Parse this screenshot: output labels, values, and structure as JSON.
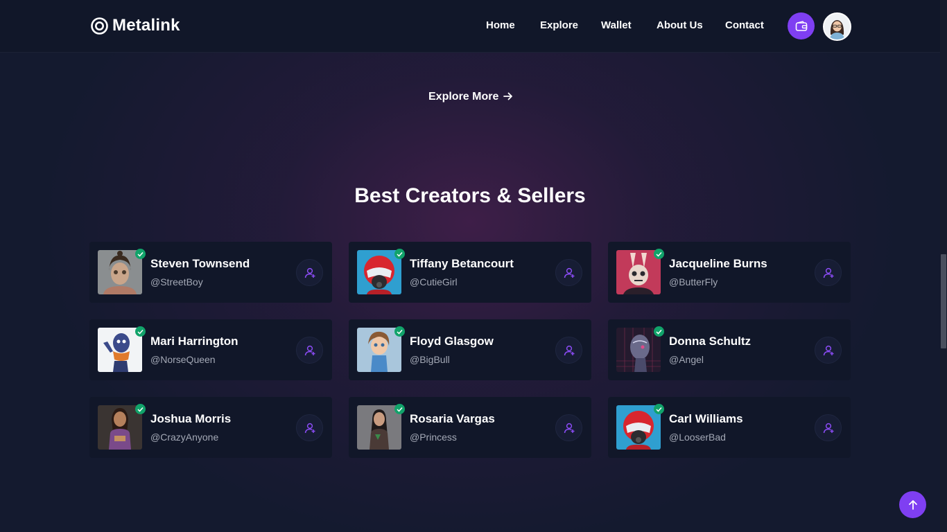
{
  "brand": {
    "name": "Metalink",
    "icon": "target-ring-icon"
  },
  "nav": {
    "items": [
      {
        "label": "Home"
      },
      {
        "label": "Explore"
      },
      {
        "label": "Wallet"
      },
      {
        "label": "About Us"
      },
      {
        "label": "Contact"
      }
    ],
    "wallet_icon": "wallet-icon",
    "avatar_icon": "user-avatar"
  },
  "explore_more": {
    "label": "Explore More",
    "icon": "arrow-right-icon"
  },
  "section": {
    "title": "Best Creators & Sellers"
  },
  "creators": [
    {
      "name": "Steven Townsend",
      "handle": "@StreetBoy",
      "thumb": "cartoon-boy"
    },
    {
      "name": "Tiffany Betancourt",
      "handle": "@CutieGirl",
      "thumb": "red-helmet"
    },
    {
      "name": "Jacqueline Burns",
      "handle": "@ButterFly",
      "thumb": "neon-bunny"
    },
    {
      "name": "Mari Harrington",
      "handle": "@NorseQueen",
      "thumb": "blue-alien"
    },
    {
      "name": "Floyd Glasgow",
      "handle": "@BigBull",
      "thumb": "cartoon-girl"
    },
    {
      "name": "Donna Schultz",
      "handle": "@Angel",
      "thumb": "cyber-head"
    },
    {
      "name": "Joshua Morris",
      "handle": "@CrazyAnyone",
      "thumb": "warrior-woman"
    },
    {
      "name": "Rosaria Vargas",
      "handle": "@Princess",
      "thumb": "fantasy-girl"
    },
    {
      "name": "Carl Williams",
      "handle": "@LooserBad",
      "thumb": "red-helmet"
    }
  ],
  "badge_icon": "verified-check-icon",
  "follow_icon": "user-add-icon",
  "scroll_top_icon": "arrow-up-icon",
  "colors": {
    "accent": "#7f3ff2",
    "background": "#141a2f",
    "card": "#111729",
    "verified": "#11a36a"
  }
}
